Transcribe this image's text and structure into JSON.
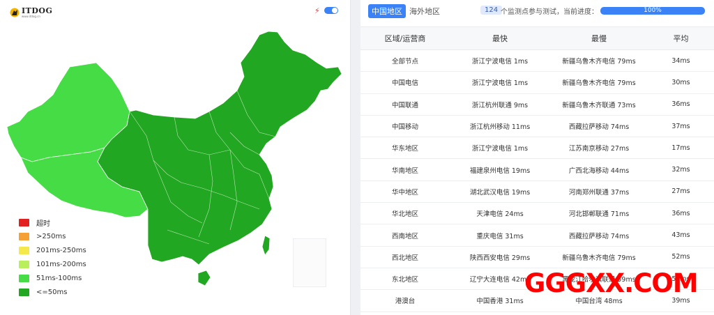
{
  "logo": {
    "text": "ITDOG",
    "subtext": "www.itdog.cn"
  },
  "map_panel": {
    "toggle_on": true
  },
  "legend": [
    {
      "label": "超时",
      "color": "#e32020"
    },
    {
      "label": ">250ms",
      "color": "#f5a033"
    },
    {
      "label": "201ms-250ms",
      "color": "#f4e84a"
    },
    {
      "label": "101ms-200ms",
      "color": "#b8ef5a"
    },
    {
      "label": "51ms-100ms",
      "color": "#46dc46"
    },
    {
      "label": "<=50ms",
      "color": "#22a722"
    }
  ],
  "tabs": [
    {
      "label": "中国地区",
      "active": true
    },
    {
      "label": "海外地区",
      "active": false
    }
  ],
  "status": {
    "count": "124",
    "label": "个监测点参与测试，当前进度：",
    "progress_text": "100%"
  },
  "table": {
    "headers": [
      "区域/运营商",
      "最快",
      "最慢",
      "平均"
    ],
    "rows": [
      [
        "全部节点",
        "浙江宁波电信 1ms",
        "新疆乌鲁木齐电信 79ms",
        "34ms"
      ],
      [
        "中国电信",
        "浙江宁波电信 1ms",
        "新疆乌鲁木齐电信 79ms",
        "30ms"
      ],
      [
        "中国联通",
        "浙江杭州联通 9ms",
        "新疆乌鲁木齐联通 73ms",
        "36ms"
      ],
      [
        "中国移动",
        "浙江杭州移动 11ms",
        "西藏拉萨移动 74ms",
        "37ms"
      ],
      [
        "华东地区",
        "浙江宁波电信 1ms",
        "江苏南京移动 27ms",
        "17ms"
      ],
      [
        "华南地区",
        "福建泉州电信 19ms",
        "广西北海移动 44ms",
        "32ms"
      ],
      [
        "华中地区",
        "湖北武汉电信 19ms",
        "河南郑州联通 37ms",
        "27ms"
      ],
      [
        "华北地区",
        "天津电信 24ms",
        "河北邯郸联通 71ms",
        "36ms"
      ],
      [
        "西南地区",
        "重庆电信 31ms",
        "西藏拉萨移动 74ms",
        "43ms"
      ],
      [
        "西北地区",
        "陕西西安电信 29ms",
        "新疆乌鲁木齐电信 79ms",
        "52ms"
      ],
      [
        "东北地区",
        "辽宁大连电信 42ms",
        "黑龙江哈尔滨联通 59ms",
        "55ms"
      ],
      [
        "港澳台",
        "中国香港 31ms",
        "中国台湾 48ms",
        "39ms"
      ]
    ]
  },
  "watermark": "GGGXX.COM"
}
